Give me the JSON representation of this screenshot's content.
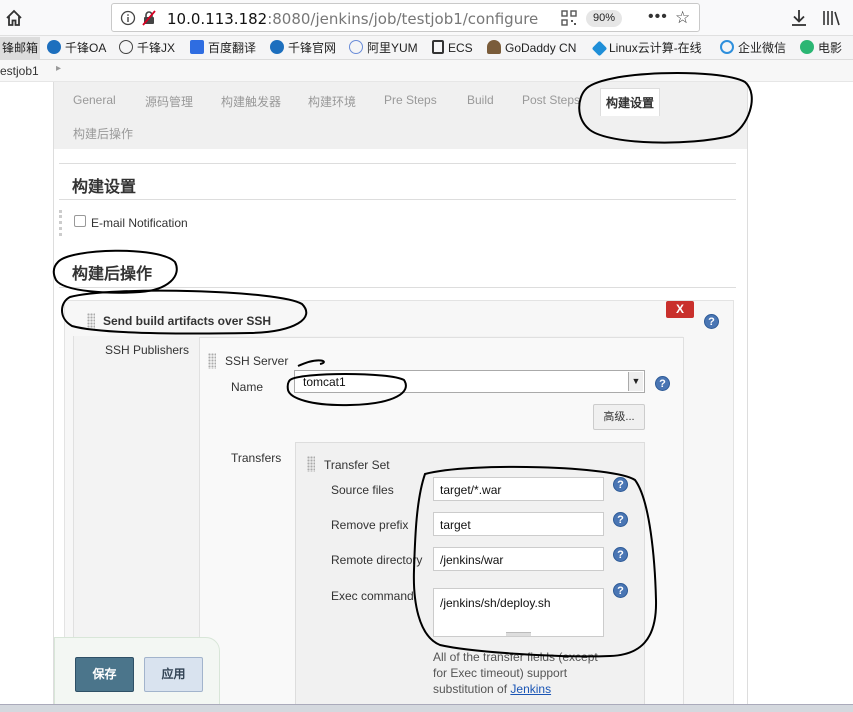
{
  "browser": {
    "url_host": "10.0.113.182",
    "url_rest": ":8080/jenkins/job/testjob1/configure",
    "zoom": "90%",
    "more_label": "•••",
    "star_label": "☆"
  },
  "bookmarks": [
    {
      "label": "锋邮箱",
      "color": "#3d7bd6"
    },
    {
      "label": "千锋OA",
      "color": "#1d6fbe"
    },
    {
      "label": "千锋JX",
      "color": "#444444"
    },
    {
      "label": "百度翻译",
      "color": "#2f6de1"
    },
    {
      "label": "千锋官网",
      "color": "#1d6fbe"
    },
    {
      "label": "阿里YUM",
      "color": "#6a8cd8"
    },
    {
      "label": "ECS",
      "color": "#333333"
    },
    {
      "label": "GoDaddy CN",
      "color": "#444444"
    },
    {
      "label": "Linux云计算-在线",
      "color": "#1f8fd8"
    },
    {
      "label": "企业微信",
      "color": "#2e8fdc"
    },
    {
      "label": "电影",
      "color": "#2bb673"
    }
  ],
  "breadcrumb": {
    "job": "estjob1",
    "sep": "▸"
  },
  "tabs": [
    {
      "label": "General"
    },
    {
      "label": "源码管理"
    },
    {
      "label": "构建触发器"
    },
    {
      "label": "构建环境"
    },
    {
      "label": "Pre Steps"
    },
    {
      "label": "Build"
    },
    {
      "label": "Post Steps"
    },
    {
      "label": "构建设置"
    },
    {
      "label": "构建后操作"
    }
  ],
  "build_settings": {
    "title": "构建设置",
    "email_label": "E-mail Notification"
  },
  "post_build": {
    "title": "构建后操作",
    "publisher_title": "Send build artifacts over SSH",
    "delete_label": "X",
    "ssh_publishers_label": "SSH Publishers",
    "ssh_server_label": "SSH Server",
    "name_label": "Name",
    "name_value": "tomcat1",
    "advanced_label": "高级...",
    "transfers_label": "Transfers",
    "transfer_set_label": "Transfer Set",
    "fields": {
      "source_files_label": "Source files",
      "source_files_value": "target/*.war",
      "remove_prefix_label": "Remove prefix",
      "remove_prefix_value": "target",
      "remote_dir_label": "Remote directory",
      "remote_dir_value": "/jenkins/war",
      "exec_cmd_label": "Exec command",
      "exec_cmd_value": "/jenkins/sh/deploy.sh"
    },
    "note_text": "All of the transfer fields (except for Exec timeout) support substitution of",
    "note_link": "Jenkins"
  },
  "buttons": {
    "save": "保存",
    "apply": "应用"
  },
  "help_glyph": "?"
}
